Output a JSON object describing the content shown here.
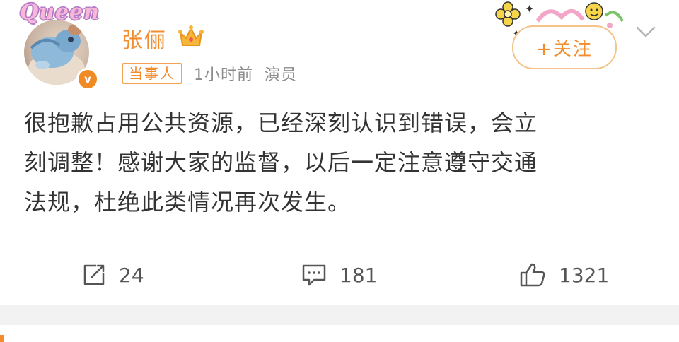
{
  "avatar": {
    "overlay_text": "Queen",
    "verified_badge": "v"
  },
  "user": {
    "name": "张俪",
    "crown_icon": "crown-icon"
  },
  "meta": {
    "tag": "当事人",
    "time": "1小时前",
    "source": "演员"
  },
  "follow": {
    "label": "+关注"
  },
  "content": {
    "lines": [
      "很抱歉占用公共资源，已经深刻认识到错误，会立",
      "刻调整！感谢大家的监督，以后一定注意遵守交通",
      "法规，杜绝此类情况再次发生。"
    ]
  },
  "actions": {
    "repost": "24",
    "comment": "181",
    "like": "1321"
  },
  "colors": {
    "accent": "#f28c2c",
    "meta_gray": "#8c8c8c",
    "divider": "#e6e6e6",
    "gap": "#f2f2f2"
  }
}
